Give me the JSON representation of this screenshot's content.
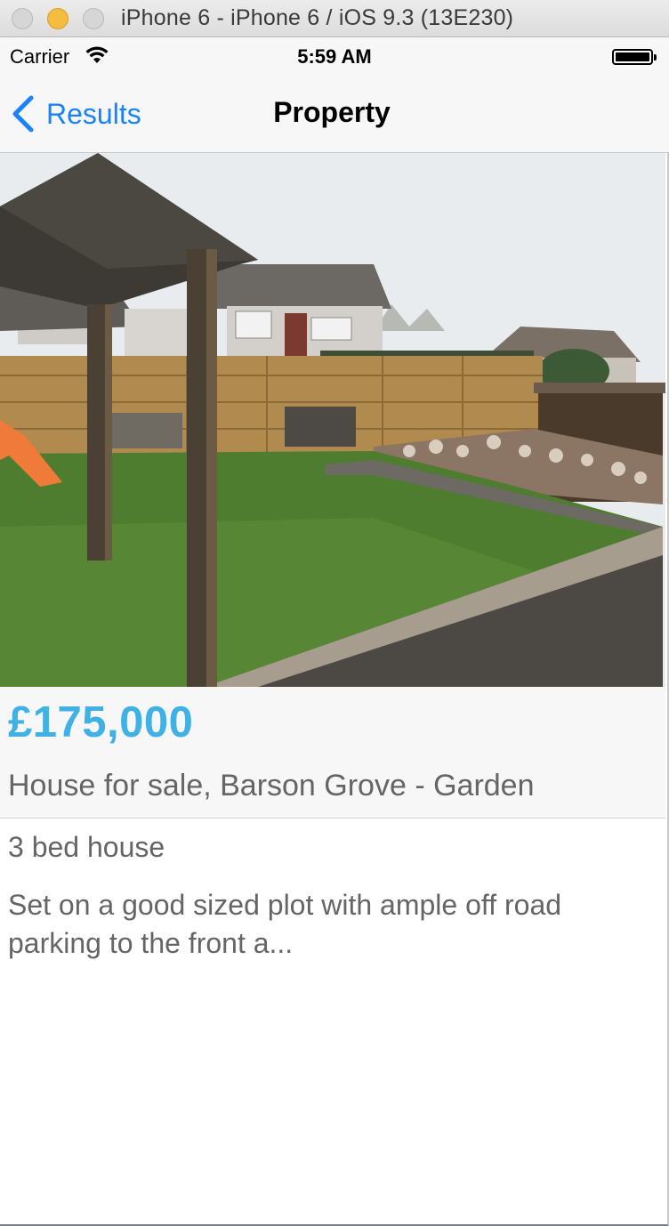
{
  "window": {
    "title": "iPhone 6 - iPhone 6 / iOS 9.3 (13E230)"
  },
  "status_bar": {
    "carrier": "Carrier",
    "time": "5:59 AM"
  },
  "nav_bar": {
    "back_label": "Results",
    "title": "Property"
  },
  "property": {
    "price": "£175,000",
    "title": "House for sale, Barson Grove - Garden",
    "bedrooms": "3 bed house",
    "summary": "Set on a good sized plot with ample off road parking to the front a..."
  },
  "colors": {
    "accent": "#1a82fb",
    "price": "#3fb1e5",
    "body_text": "#656565"
  },
  "icons": [
    "wifi-icon",
    "battery-icon",
    "back-chevron-icon"
  ]
}
